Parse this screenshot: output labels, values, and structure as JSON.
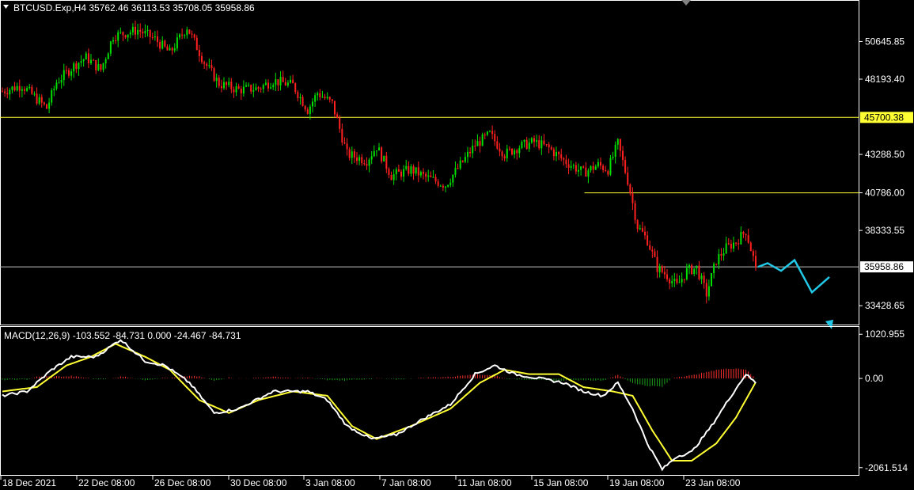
{
  "window": {
    "symbol_info": "BTCUSD.Exp,H4  35762.46 36113.53 35708.05 35958.86"
  },
  "colors": {
    "background": "#000000",
    "bull": "#00e000",
    "bear": "#ff2020",
    "grid": "#ffffff",
    "hline_yellow": "#ffff33",
    "hline_current": "#c0c0c0",
    "macd_line": "#ffffff",
    "signal_line": "#ffff33",
    "hist_pos": "#ff3030",
    "hist_neg": "#1aa01a",
    "projection": "#22c8e6"
  },
  "chart_data": [
    {
      "type": "candlestick",
      "title": "BTCUSD.Exp,H4  35762.46 36113.53 35708.05 35958.86",
      "yaxis_ticks": [
        50645.85,
        48193.4,
        43288.5,
        40786.0,
        38333.55,
        33428.65
      ],
      "ylim": [
        32200,
        53300
      ],
      "current_price": "35958.86",
      "horizontal_lines": [
        {
          "price": 45700.38,
          "label": "45700.38",
          "color": "yellow"
        },
        {
          "price": 40786.0,
          "color": "yellow",
          "start_fraction": 0.68
        }
      ],
      "x_tick_labels": [
        "18 Dec 2021",
        "22 Dec 08:00",
        "26 Dec 08:00",
        "30 Dec 08:00",
        "3 Jan 08:00",
        "7 Jan 08:00",
        "11 Jan 08:00",
        "15 Jan 08:00",
        "19 Jan 08:00",
        "23 Jan 08:00"
      ],
      "close_path_keypoints": [
        [
          0,
          47400
        ],
        [
          8,
          47800
        ],
        [
          12,
          47200
        ],
        [
          18,
          46300
        ],
        [
          22,
          48000
        ],
        [
          30,
          49200
        ],
        [
          34,
          49600
        ],
        [
          40,
          48800
        ],
        [
          45,
          51000
        ],
        [
          55,
          51400
        ],
        [
          62,
          50800
        ],
        [
          68,
          49900
        ],
        [
          75,
          51600
        ],
        [
          82,
          49300
        ],
        [
          88,
          47900
        ],
        [
          96,
          47500
        ],
        [
          104,
          47600
        ],
        [
          110,
          48100
        ],
        [
          118,
          47800
        ],
        [
          124,
          46200
        ],
        [
          128,
          47300
        ],
        [
          134,
          46600
        ],
        [
          140,
          43300
        ],
        [
          148,
          42900
        ],
        [
          152,
          43800
        ],
        [
          158,
          41900
        ],
        [
          166,
          42300
        ],
        [
          172,
          41800
        ],
        [
          180,
          41300
        ],
        [
          186,
          42600
        ],
        [
          192,
          43900
        ],
        [
          198,
          44600
        ],
        [
          204,
          43300
        ],
        [
          210,
          43800
        ],
        [
          216,
          44100
        ],
        [
          222,
          43700
        ],
        [
          228,
          42900
        ],
        [
          236,
          42100
        ],
        [
          242,
          42600
        ],
        [
          246,
          42300
        ],
        [
          250,
          44000
        ],
        [
          254,
          41600
        ],
        [
          258,
          38600
        ],
        [
          262,
          37700
        ],
        [
          266,
          35900
        ],
        [
          270,
          35400
        ],
        [
          274,
          34700
        ],
        [
          278,
          35700
        ],
        [
          282,
          35900
        ],
        [
          286,
          34200
        ],
        [
          290,
          36400
        ],
        [
          294,
          37200
        ],
        [
          298,
          37600
        ],
        [
          302,
          38300
        ],
        [
          306,
          35958.86
        ]
      ],
      "projection_path": [
        35958.86,
        36200,
        35700,
        36400,
        34300,
        35300,
        31900
      ]
    },
    {
      "type": "macd",
      "title": "MACD(12,26,9) -103.552 -84.731 0.000 -24.467 -84.731",
      "yaxis_ticks": [
        "1020.955",
        "0.00",
        "-2061.514"
      ],
      "ylim": [
        -2230,
        1190
      ],
      "macd_keypoints": [
        [
          0,
          -400
        ],
        [
          10,
          -300
        ],
        [
          20,
          200
        ],
        [
          28,
          500
        ],
        [
          38,
          500
        ],
        [
          48,
          900
        ],
        [
          58,
          400
        ],
        [
          66,
          300
        ],
        [
          76,
          -100
        ],
        [
          86,
          -800
        ],
        [
          96,
          -700
        ],
        [
          110,
          -300
        ],
        [
          124,
          -300
        ],
        [
          132,
          -500
        ],
        [
          140,
          -1100
        ],
        [
          150,
          -1400
        ],
        [
          160,
          -1300
        ],
        [
          172,
          -900
        ],
        [
          182,
          -600
        ],
        [
          192,
          100
        ],
        [
          200,
          300
        ],
        [
          208,
          100
        ],
        [
          218,
          0
        ],
        [
          228,
          -100
        ],
        [
          236,
          -300
        ],
        [
          244,
          -400
        ],
        [
          250,
          -100
        ],
        [
          256,
          -700
        ],
        [
          262,
          -1500
        ],
        [
          268,
          -2100
        ],
        [
          274,
          -1800
        ],
        [
          280,
          -1700
        ],
        [
          288,
          -1100
        ],
        [
          296,
          -400
        ],
        [
          302,
          100
        ],
        [
          306,
          -104
        ]
      ],
      "signal_keypoints": [
        [
          0,
          -300
        ],
        [
          14,
          -200
        ],
        [
          26,
          300
        ],
        [
          36,
          500
        ],
        [
          46,
          800
        ],
        [
          58,
          500
        ],
        [
          68,
          200
        ],
        [
          80,
          -500
        ],
        [
          92,
          -800
        ],
        [
          104,
          -500
        ],
        [
          118,
          -300
        ],
        [
          132,
          -400
        ],
        [
          142,
          -1100
        ],
        [
          152,
          -1400
        ],
        [
          166,
          -1100
        ],
        [
          182,
          -700
        ],
        [
          194,
          -100
        ],
        [
          204,
          200
        ],
        [
          214,
          100
        ],
        [
          226,
          100
        ],
        [
          236,
          -200
        ],
        [
          248,
          -300
        ],
        [
          256,
          -400
        ],
        [
          264,
          -1200
        ],
        [
          272,
          -1900
        ],
        [
          280,
          -1900
        ],
        [
          290,
          -1500
        ],
        [
          298,
          -900
        ],
        [
          306,
          -85
        ]
      ]
    }
  ]
}
